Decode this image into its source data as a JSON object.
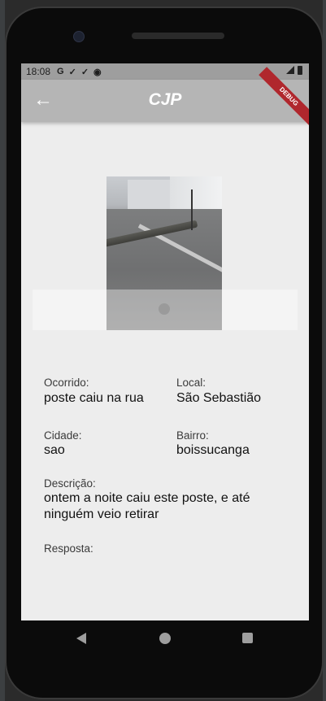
{
  "status_bar": {
    "time": "18:08",
    "icons": [
      "google-icon",
      "check-download-icon",
      "check-download-icon",
      "app-icon"
    ],
    "right_icons": [
      "wifi-icon",
      "signal-icon",
      "battery-icon"
    ]
  },
  "app_bar": {
    "title": "CJP",
    "back_icon": "arrow-left-icon",
    "debug_banner": "DEBUG"
  },
  "details": {
    "ocorrido": {
      "label": "Ocorrido:",
      "value": "poste caiu na rua"
    },
    "local": {
      "label": "Local:",
      "value": "São Sebastião"
    },
    "cidade": {
      "label": "Cidade:",
      "value": "sao"
    },
    "bairro": {
      "label": "Bairro:",
      "value": "boissucanga"
    },
    "descricao": {
      "label": "Descrição:",
      "value": "ontem a noite caiu este poste, e até ninguém veio retirar"
    },
    "resposta": {
      "label": "Resposta:",
      "value": ""
    }
  },
  "nav_bar": {
    "buttons": [
      "back-triangle-icon",
      "home-circle-icon",
      "recents-square-icon"
    ]
  },
  "colors": {
    "app_bar": "#b5b5b5",
    "status_bar": "#9e9e9e",
    "background": "#ededed",
    "debug_ribbon": "#b0272d"
  }
}
